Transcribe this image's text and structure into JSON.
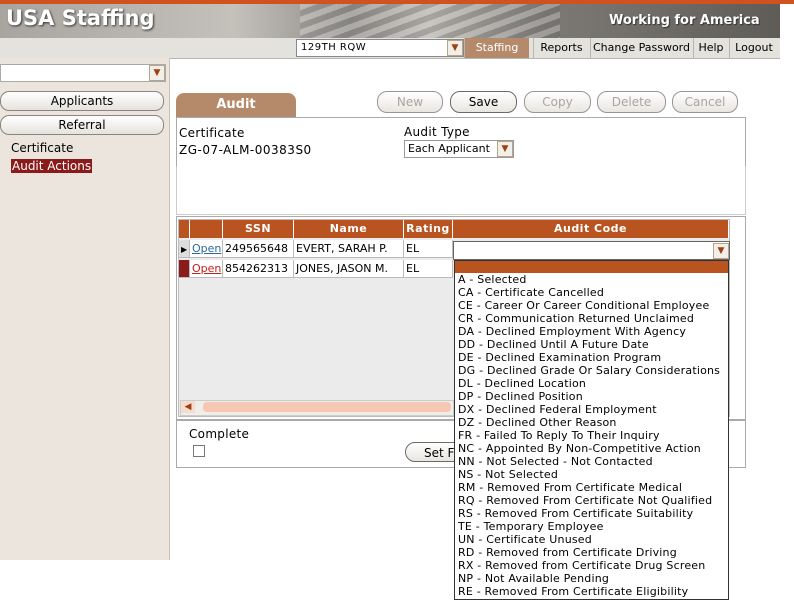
{
  "header": {
    "logo": "USA Staffing",
    "tagline": "Working for America",
    "org_select": "129TH RQW",
    "nav": {
      "staffing": "Staffing",
      "reports": "Reports",
      "change_password": "Change Password",
      "help": "Help",
      "logout": "Logout"
    }
  },
  "sidebar": {
    "select_value": "",
    "applicants": "Applicants",
    "referral": "Referral",
    "certificate": "Certificate",
    "audit_actions": "Audit Actions"
  },
  "toolbar": {
    "tab": "Audit",
    "new": "New",
    "save": "Save",
    "copy": "Copy",
    "delete": "Delete",
    "cancel": "Cancel"
  },
  "form": {
    "certificate_label": "Certificate",
    "certificate_value": "ZG-07-ALM-00383S0",
    "audit_type_label": "Audit Type",
    "audit_type_value": "Each Applicant"
  },
  "grid": {
    "columns": [
      "SSN",
      "Name",
      "Rating",
      "Audit Code"
    ],
    "rows": [
      {
        "open": "Open",
        "ssn": "249565648",
        "name": "EVERT, SARAH P.",
        "rating": "EL",
        "audit_code": ""
      },
      {
        "open": "Open",
        "ssn": "854262313",
        "name": "JONES, JASON M.",
        "rating": "EL",
        "audit_code": ""
      }
    ]
  },
  "footer": {
    "complete_label": "Complete",
    "set_button": "Set F"
  },
  "audit_code_options": [
    "A - Selected",
    "CA - Certificate Cancelled",
    "CE - Career Or Career Conditional Employee",
    "CR - Communication Returned Unclaimed",
    "DA - Declined Employment With Agency",
    "DD - Declined Until A Future Date",
    "DE - Declined Examination Program",
    "DG - Declined Grade Or Salary Considerations",
    "DL - Declined Location",
    "DP - Declined Position",
    "DX - Declined Federal Employment",
    "DZ - Declined Other Reason",
    "FR - Failed To Reply To Their Inquiry",
    "NC - Appointed By Non-Competitive Action",
    "NN - Not Selected - Not Contacted",
    "NS - Not Selected",
    "RM - Removed From Certificate Medical",
    "RQ - Removed From Certificate Not Qualified",
    "RS - Removed From Certificate Suitability",
    "TE - Temporary Employee",
    "UN - Certificate Unused",
    "RD - Removed from Certificate Driving",
    "RX - Removed from Certificate Drug Screen",
    "NP - Not Available Pending",
    "RE - Removed From Certificate Eligibility"
  ],
  "colors": {
    "accent": "#b9531f",
    "tab": "#b48a6b",
    "selected_link_bg": "#8b1a1a"
  }
}
